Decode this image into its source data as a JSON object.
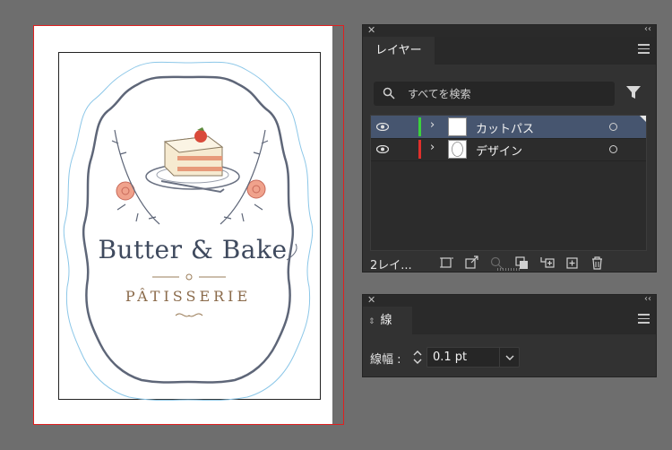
{
  "artboard": {
    "brand_title": "Butter & Bake",
    "brand_subtitle": "PÂTISSERIE"
  },
  "layers_panel": {
    "tab_label": "レイヤー",
    "search_placeholder": "すべてを検索",
    "layers": [
      {
        "name": "カットパス",
        "color": "#3cd13c",
        "selected": true
      },
      {
        "name": "デザイン",
        "color": "#e0302c",
        "selected": false
      }
    ],
    "layer_count": "2レイ..."
  },
  "stroke_panel": {
    "tab_label": "線",
    "stroke_width_label": "線幅 :",
    "stroke_width_value": "0.1 pt"
  },
  "icons": [
    "close-icon",
    "collapse-icon",
    "panel-menu-icon",
    "search-icon",
    "filter-icon",
    "eye-icon",
    "chevron-right-icon",
    "target-circle-icon",
    "collect-for-export-icon",
    "export-icon",
    "locate-object-icon",
    "make-clipping-mask-icon",
    "new-sublayer-icon",
    "new-layer-icon",
    "delete-layer-icon",
    "stepper-icon",
    "dropdown-chevron-icon"
  ]
}
